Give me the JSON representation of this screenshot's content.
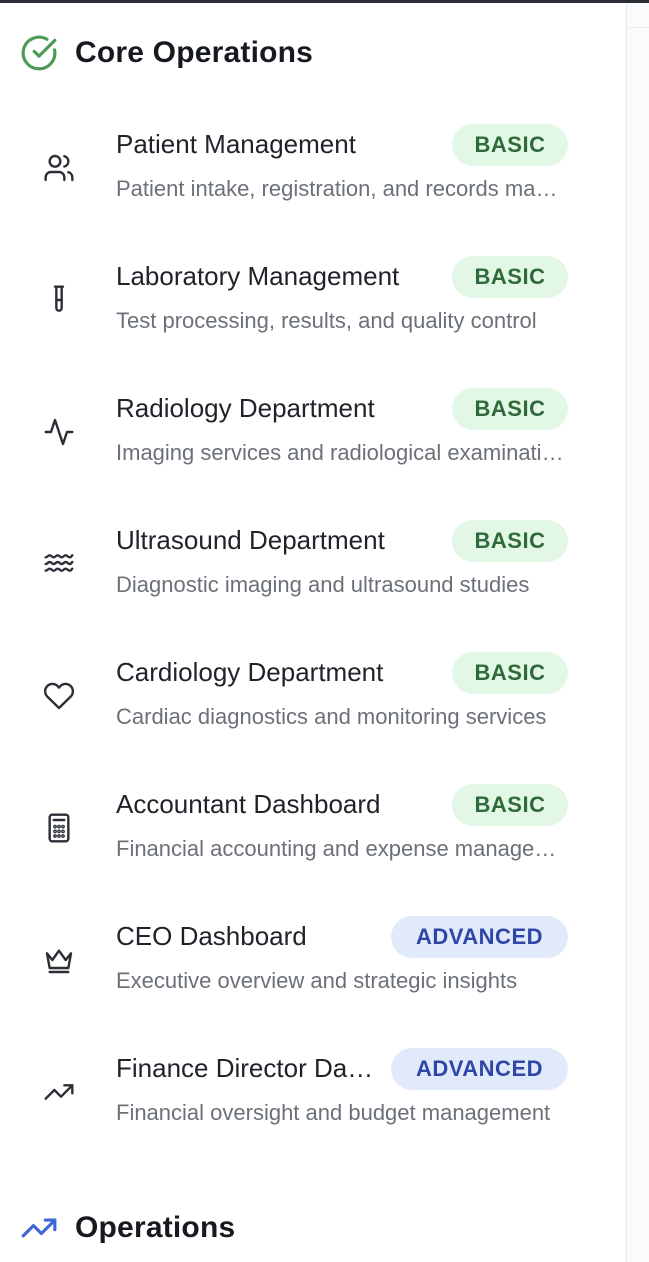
{
  "sections": [
    {
      "title": "Core Operations",
      "icon": "check-circle-icon",
      "icon_color": "#4e9a57"
    },
    {
      "title": "Operations",
      "icon": "trending-up-icon",
      "icon_color": "#3f67d6"
    }
  ],
  "items": [
    {
      "title": "Patient Management",
      "desc": "Patient intake, registration, and records management",
      "badge": "BASIC",
      "icon": "users-icon"
    },
    {
      "title": "Laboratory Management",
      "desc": "Test processing, results, and quality control",
      "badge": "BASIC",
      "icon": "test-tube-icon"
    },
    {
      "title": "Radiology Department",
      "desc": "Imaging services and radiological examinations",
      "badge": "BASIC",
      "icon": "activity-icon"
    },
    {
      "title": "Ultrasound Department",
      "desc": "Diagnostic imaging and ultrasound studies",
      "badge": "BASIC",
      "icon": "waves-icon"
    },
    {
      "title": "Cardiology Department",
      "desc": "Cardiac diagnostics and monitoring services",
      "badge": "BASIC",
      "icon": "heart-icon"
    },
    {
      "title": "Accountant Dashboard",
      "desc": "Financial accounting and expense management",
      "badge": "BASIC",
      "icon": "calculator-icon"
    },
    {
      "title": "CEO Dashboard",
      "desc": "Executive overview and strategic insights",
      "badge": "ADVANCED",
      "icon": "crown-icon"
    },
    {
      "title": "Finance Director Dashboard",
      "desc": "Financial oversight and budget management",
      "badge": "ADVANCED",
      "icon": "trending-up-icon"
    }
  ],
  "colors": {
    "basic_badge_bg": "#e3f7e6",
    "basic_badge_text": "#2f6a3a",
    "advanced_badge_bg": "#e1eafb",
    "advanced_badge_text": "#2f46a8"
  }
}
